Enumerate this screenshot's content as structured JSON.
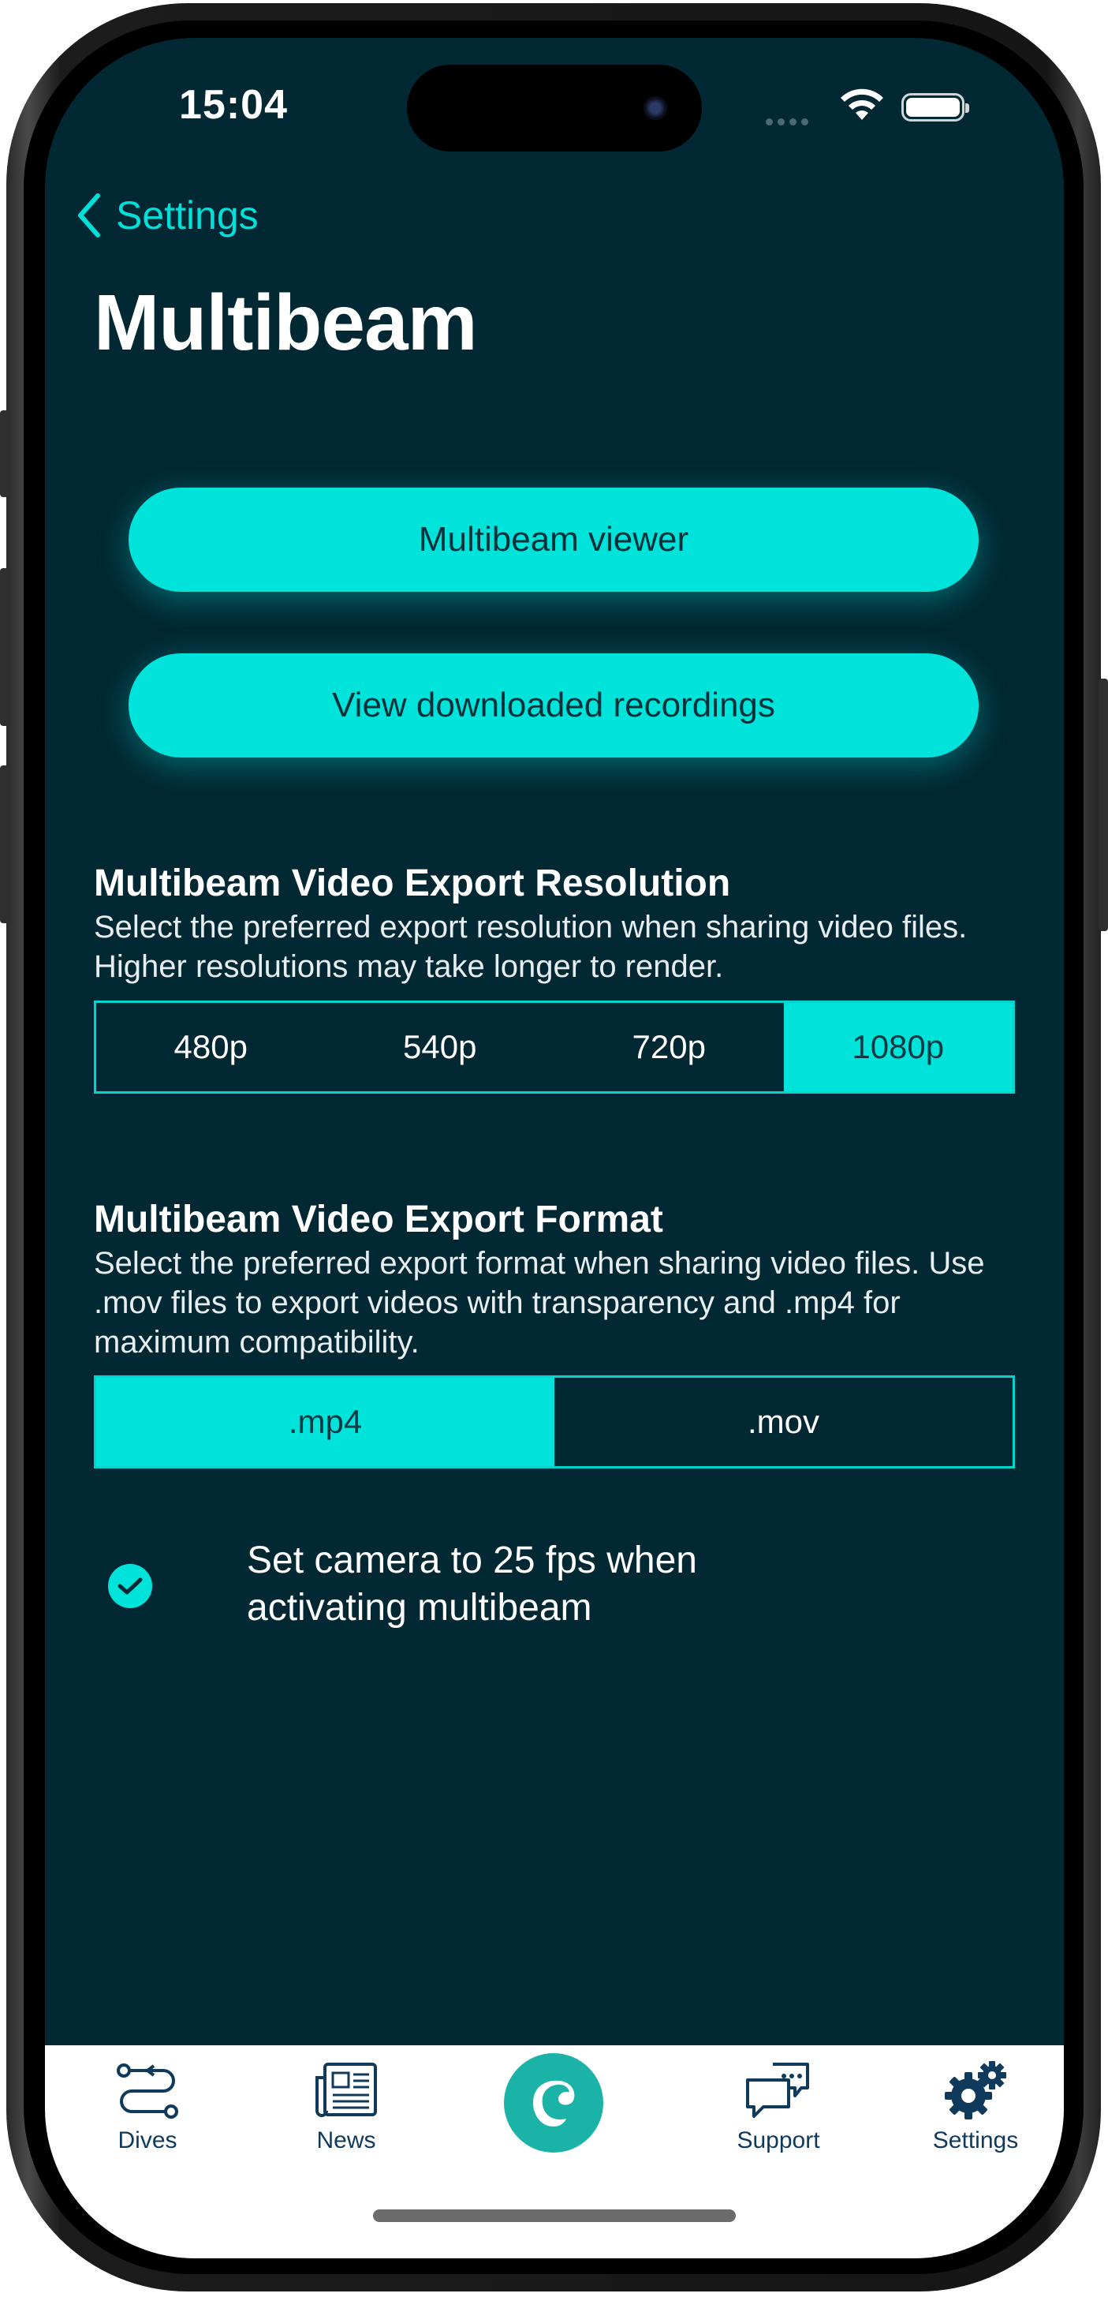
{
  "status": {
    "time": "15:04"
  },
  "nav": {
    "back_label": "Settings",
    "title": "Multibeam"
  },
  "actions": {
    "viewer_label": "Multibeam viewer",
    "recordings_label": "View downloaded recordings"
  },
  "resolution": {
    "heading": "Multibeam Video Export Resolution",
    "description": "Select the preferred export resolution when sharing video files. Higher resolutions may take longer to render.",
    "options": [
      "480p",
      "540p",
      "720p",
      "1080p"
    ],
    "selected": "1080p"
  },
  "format": {
    "heading": "Multibeam Video Export Format",
    "description": "Select the preferred export format when sharing video files. Use .mov files to export videos with transparency and .mp4 for maximum compatibility.",
    "options": [
      ".mp4",
      ".mov"
    ],
    "selected": ".mp4"
  },
  "fps_option": {
    "label": "Set camera to 25 fps when activating multibeam",
    "checked": true
  },
  "tabbar": {
    "items": [
      {
        "label": "Dives",
        "icon": "route-icon"
      },
      {
        "label": "News",
        "icon": "newspaper-icon"
      },
      {
        "label": "",
        "icon": "app-logo-icon"
      },
      {
        "label": "Support",
        "icon": "chat-bubbles-icon"
      },
      {
        "label": "Settings",
        "icon": "gears-icon"
      }
    ]
  },
  "colors": {
    "background": "#022833",
    "accent": "#00e3da",
    "tab_text": "#0f3a5c"
  }
}
